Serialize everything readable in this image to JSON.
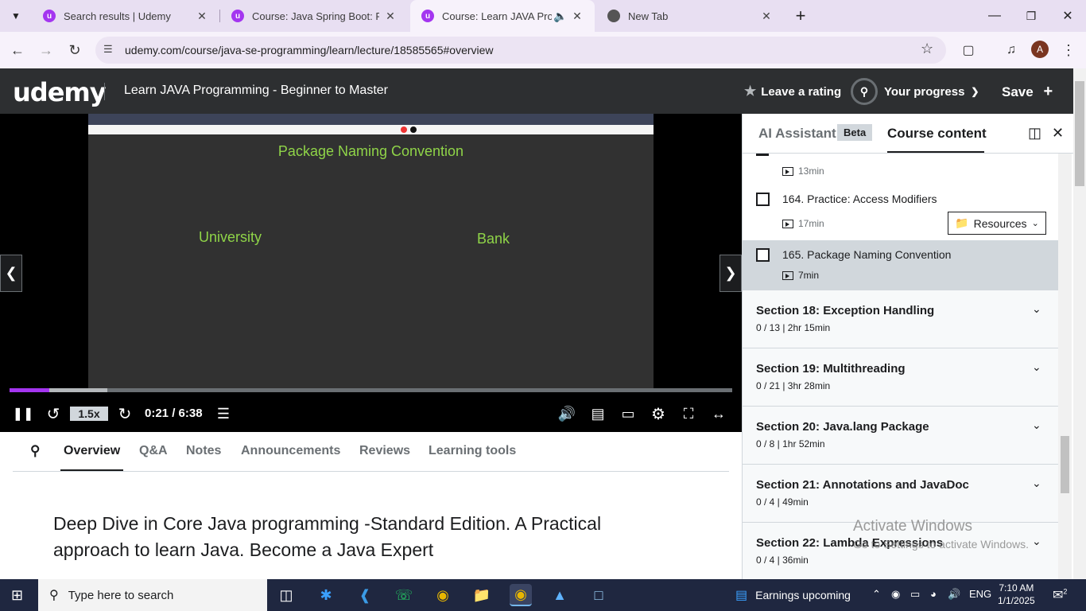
{
  "browser": {
    "tabs": [
      {
        "title": "Search results | Udemy",
        "active": false
      },
      {
        "title": "Course: Java Spring Boot: Profe",
        "active": false
      },
      {
        "title": "Course: Learn JAVA Progran",
        "active": true,
        "audio": true
      },
      {
        "title": "New Tab",
        "active": false
      }
    ],
    "new_tab_symbol": "+",
    "url": "udemy.com/course/java-se-programming/learn/lecture/18585565#overview",
    "profile_initial": "A"
  },
  "header": {
    "logo": "udemy",
    "course_title": "Learn JAVA Programming - Beginner to Master",
    "rate_label": "Leave a rating",
    "progress_label": "Your progress",
    "save_label": "Save"
  },
  "video": {
    "slide_title": "Package Naming Convention",
    "slide_words": [
      "University",
      "Bank"
    ],
    "speed": "1.5x",
    "timecode": "0:21 / 6:38",
    "played_fraction": 0.055,
    "buffered_fraction": 0.135
  },
  "subtabs": [
    "Overview",
    "Q&A",
    "Notes",
    "Announcements",
    "Reviews",
    "Learning tools"
  ],
  "description": "Deep Dive in Core Java programming -Standard Edition. A Practical approach to learn Java. Become a Java Expert",
  "sidebar": {
    "ai_tab": "AI Assistant",
    "beta": "Beta",
    "content_tab": "Course content",
    "prev_duration": "13min",
    "lectures": [
      {
        "title": "164. Practice: Access Modifiers",
        "duration": "17min",
        "resources": "Resources"
      },
      {
        "title": "165. Package Naming Convention",
        "duration": "7min"
      }
    ],
    "sections": [
      {
        "title": "Section 18: Exception Handling",
        "meta": "0 / 13 | 2hr 15min"
      },
      {
        "title": "Section 19: Multithreading",
        "meta": "0 / 21 | 3hr 28min"
      },
      {
        "title": "Section 20: Java.lang Package",
        "meta": "0 / 8 | 1hr 52min"
      },
      {
        "title": "Section 21: Annotations and JavaDoc",
        "meta": "0 / 4 | 49min"
      },
      {
        "title": "Section 22: Lambda Expressions",
        "meta": "0 / 4 | 36min"
      }
    ]
  },
  "watermark": {
    "line1": "Activate Windows",
    "line2": "Go to Settings to activate Windows."
  },
  "taskbar": {
    "search_placeholder": "Type here to search",
    "news": "Earnings upcoming",
    "language": "ENG",
    "time": "7:10 AM",
    "date": "1/1/2025",
    "notification_count": "2"
  }
}
